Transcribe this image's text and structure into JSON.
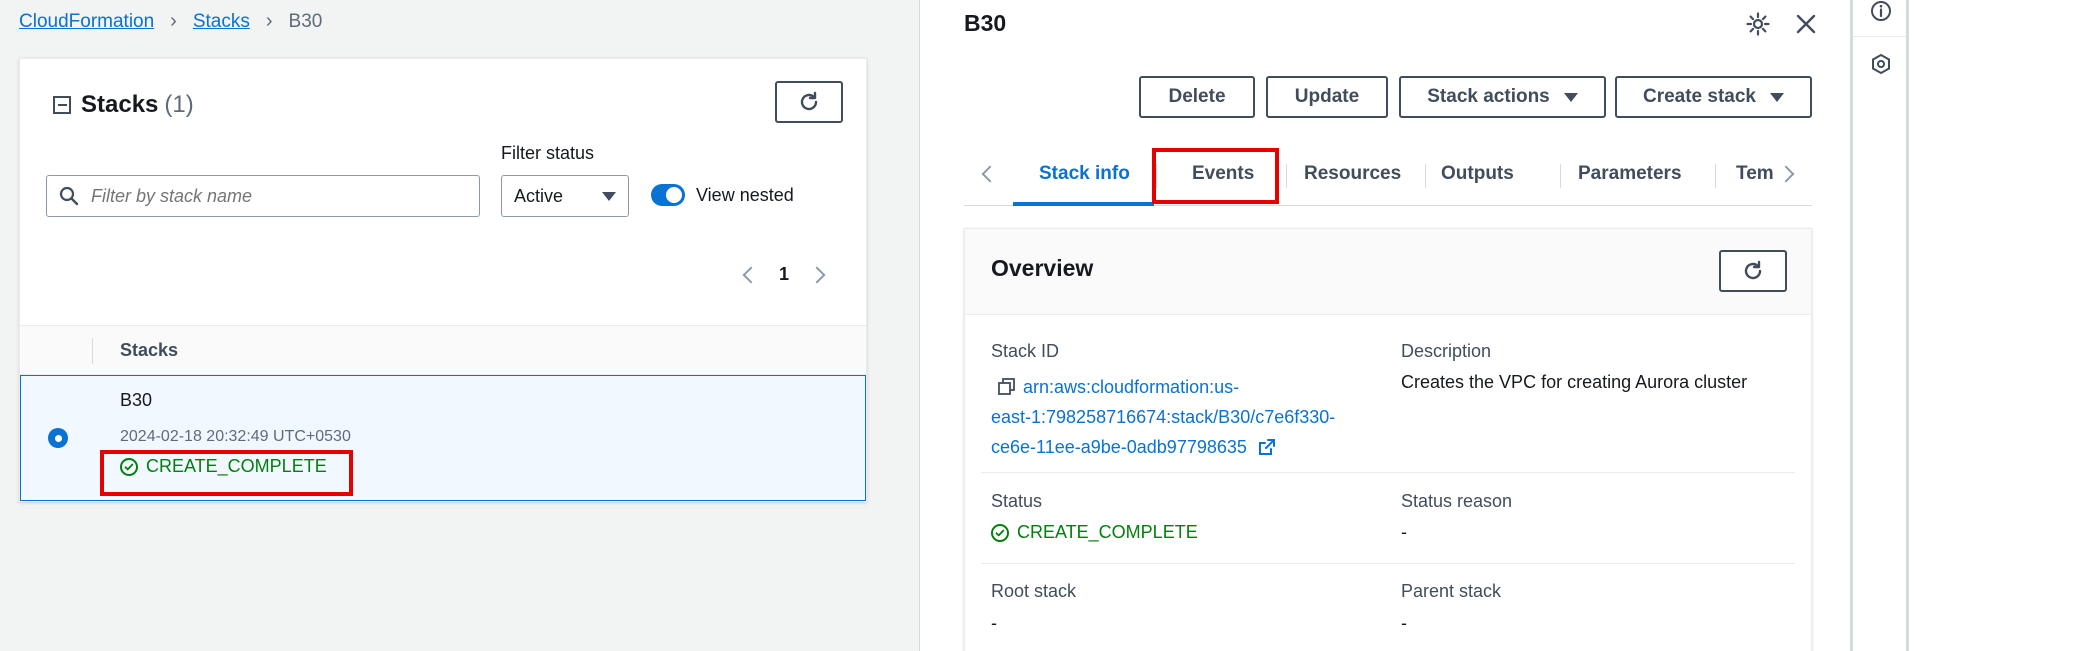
{
  "breadcrumb": {
    "items": [
      "CloudFormation",
      "Stacks"
    ],
    "current": "B30"
  },
  "stacks_panel": {
    "title": "Stacks",
    "count": "(1)",
    "search_placeholder": "Filter by stack name",
    "filter_label": "Filter status",
    "filter_value": "Active",
    "view_nested_label": "View nested",
    "view_nested_on": true,
    "page_number": "1",
    "column_header": "Stacks",
    "rows": [
      {
        "name": "B30",
        "created": "2024-02-18 20:32:49 UTC+0530",
        "status": "CREATE_COMPLETE",
        "selected": true
      }
    ]
  },
  "detail": {
    "title": "B30",
    "buttons": {
      "delete": "Delete",
      "update": "Update",
      "stack_actions": "Stack actions",
      "create_stack": "Create stack"
    },
    "tabs": [
      "Stack info",
      "Events",
      "Resources",
      "Outputs",
      "Parameters",
      "Tem"
    ],
    "active_tab": "Stack info",
    "overview": {
      "title": "Overview",
      "stack_id_label": "Stack ID",
      "stack_id_lines": [
        "arn:aws:cloudformation:us-",
        "east-1:798258716674:stack/B30/c7e6f330-",
        "ce6e-11ee-a9be-0adb97798635"
      ],
      "description_label": "Description",
      "description_value": "Creates the VPC for creating Aurora cluster",
      "status_label": "Status",
      "status_value": "CREATE_COMPLETE",
      "status_reason_label": "Status reason",
      "status_reason_value": "-",
      "root_stack_label": "Root stack",
      "root_stack_value": "-",
      "parent_stack_label": "Parent stack",
      "parent_stack_value": "-"
    }
  },
  "colors": {
    "link": "#0972d3",
    "success": "#037f0c",
    "highlight": "#e60000",
    "selected_bg": "#f1f8ff"
  }
}
